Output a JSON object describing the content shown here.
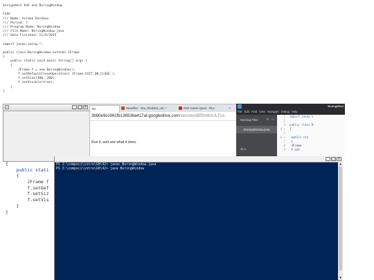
{
  "doc": {
    "lines": [
      "Assignment #42 and BoringWindow",
      "",
      "Code",
      "/// Name: Yordan Rashkov",
      "/// Period: 7",
      "/// Program Name: BoringWindow",
      "/// File Name: BoringWindow.java",
      "/// Date Finished: 11/9/2015",
      "",
      "import javax.swing.*;",
      "",
      "public class BoringWindow extends JFrame",
      "{",
      "    public static void main( String[] args )",
      "    {",
      "        JFrame f = new BoringWindow();",
      "        f.setDefaultCloseOperation( JFrame.EXIT_ON_CLOSE );",
      "        f.setSize(300, 200);",
      "        f.setVisible(true);",
      "    }",
      "}"
    ],
    "lower_lines": [
      "{",
      "    public stati",
      "    {",
      "        JFrame f",
      "        f.setDef",
      "        f.setSiz",
      "        f.setVis",
      "    }",
      "}"
    ]
  },
  "jframe": {
    "min": "_",
    "max": "□",
    "close": "×"
  },
  "browser": {
    "tabs": [
      {
        "label": "ble",
        "color": "#ffffff"
      },
      {
        "label": "Newsflex - She_Riedded_onl",
        "color": "#d0451b"
      },
      {
        "label": "Rich Homie Quan - Flex",
        "color": "#e62117"
      }
    ],
    "tab_close": "×",
    "new_tab": "+",
    "url_main": "3b80e9cc961fb136536a417af.googledrive.com",
    "url_rest": "/secure/AB5fxWAULFus",
    "content_text": "Run it, and see what it does."
  },
  "editor": {
    "title": "BoringWind",
    "menu": [
      "File",
      "Edit",
      "Find",
      "View",
      "Navigate",
      "Debug",
      "Help"
    ],
    "working_files_label": "Working Files",
    "active_file": "BoringWindow.java",
    "project_label": "42 ",
    "code_lines": [
      {
        "n": "1",
        "text": "import javax.s"
      },
      {
        "n": "2",
        "text": ""
      },
      {
        "n": "3",
        "text": "public class B"
      },
      {
        "n": "4 ▾",
        "text": "{"
      },
      {
        "n": "5",
        "text": ""
      },
      {
        "n": "6 ▾",
        "text": "    public sta"
      },
      {
        "n": "7",
        "text": "    {"
      },
      {
        "n": "8",
        "text": "        JFrame"
      },
      {
        "n": "9",
        "text": "        f.set"
      }
    ]
  },
  "console": {
    "lines": [
      "PS Z:\\compsci\\intro\\GH\\42> javac BoringWindow.java",
      "PS Z:\\compsci\\intro\\GH\\42> java BoringWindow"
    ]
  },
  "colors": {
    "console_bg": "#012456",
    "editor_bg": "#1f2023",
    "editor_sidebar": "#47484b"
  }
}
